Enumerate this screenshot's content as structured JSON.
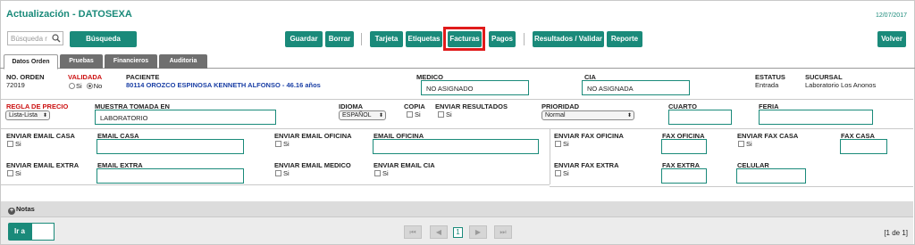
{
  "header": {
    "title": "Actualización - DATOSEXA",
    "date": "12/07/2017"
  },
  "toolbar": {
    "search_placeholder": "Búsqueda r",
    "busqueda_dinamica": "Búsqueda dinámica",
    "guardar": "Guardar",
    "borrar": "Borrar",
    "tarjeta": "Tarjeta",
    "etiquetas": "Etiquetas",
    "facturas": "Facturas",
    "pagos": "Pagos",
    "resultados_validar": "Resultados / Validar",
    "reporte": "Reporte",
    "volver": "Volver",
    "accent": "#1a8a7a",
    "highlight_color": "#e01b1b"
  },
  "tabs": [
    "Datos Orden",
    "Pruebas",
    "Financieros",
    "Auditoria"
  ],
  "orden": {
    "no_orden_label": "NO. ORDEN",
    "no_orden_value": "72019",
    "validada_label": "VALIDADA",
    "si": "Si",
    "no": "No",
    "paciente_label": "PACIENTE",
    "paciente_value": "80114 OROZCO ESPINOSA KENNETH ALFONSO - 46.16 años",
    "medico_label": "MEDICO",
    "medico_value": "NO ASIGNADO",
    "cia_label": "CIA",
    "cia_value": "NO ASIGNADA",
    "estatus_label": "ESTATUS",
    "estatus_value": "Entrada",
    "sucursal_label": "SUCURSAL",
    "sucursal_value": "Laboratorio Los Anonos"
  },
  "row2": {
    "regla_label": "REGLA DE PRECIO",
    "regla_value": "Lista-Lista",
    "muestra_label": "MUESTRA TOMADA EN",
    "muestra_value": "LABORATORIO",
    "idioma_label": "IDIOMA",
    "idioma_value": "ESPAÑOL",
    "copia_label": "COPIA",
    "enviar_resultados_label": "ENVIAR RESULTADOS",
    "prioridad_label": "PRIORIDAD",
    "prioridad_value": "Normal",
    "cuarto_label": "CUARTO",
    "feria_label": "FERIA"
  },
  "row3": {
    "enviar_email_casa": "ENVIAR EMAIL CASA",
    "email_casa": "EMAIL CASA",
    "enviar_email_oficina": "ENVIAR EMAIL OFICINA",
    "email_oficina": "EMAIL OFICINA",
    "enviar_fax_oficina": "ENVIAR FAX OFICINA",
    "fax_oficina": "FAX OFICINA",
    "enviar_fax_casa": "ENVIAR FAX CASA",
    "fax_casa": "FAX CASA"
  },
  "row4": {
    "enviar_email_extra": "ENVIAR EMAIL EXTRA",
    "email_extra": "EMAIL EXTRA",
    "enviar_email_medico": "ENVIAR EMAIL MEDICO",
    "enviar_email_cia": "ENVIAR EMAIL CIA",
    "enviar_fax_extra": "ENVIAR FAX EXTRA",
    "fax_extra": "FAX EXTRA",
    "celular": "CELULAR"
  },
  "notas": {
    "label": "Notas",
    "plus": "+"
  },
  "footer": {
    "ir_a": "Ir a",
    "first": "⏮",
    "prev": "◀",
    "page": "1",
    "next": "▶",
    "last": "⏭",
    "info": "[1 de 1]"
  }
}
